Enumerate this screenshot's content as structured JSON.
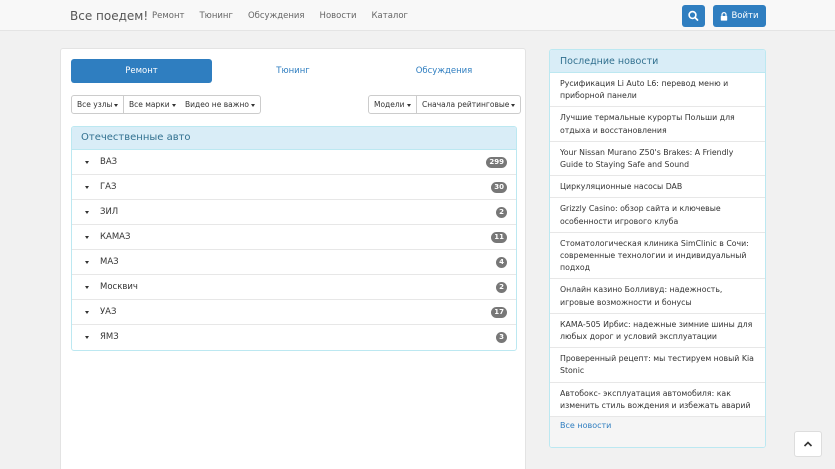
{
  "navbar": {
    "brand": "Все поедем!",
    "links": [
      "Ремонт",
      "Тюнинг",
      "Обсуждения",
      "Новости",
      "Каталог"
    ],
    "login_label": "Войти",
    "accent": "#2f7ec0"
  },
  "tabs": [
    "Ремонт",
    "Тюнинг",
    "Обсуждения"
  ],
  "filters": {
    "nodes": "Все узлы",
    "brands": "Все марки",
    "video": "Видео не важно",
    "models": "Модели",
    "sort": "Сначала рейтинговые"
  },
  "panel": {
    "title": "Отечественные авто",
    "items": [
      {
        "name": "ВАЗ",
        "count": "299"
      },
      {
        "name": "ГАЗ",
        "count": "30"
      },
      {
        "name": "ЗИЛ",
        "count": "2"
      },
      {
        "name": "КАМАЗ",
        "count": "11"
      },
      {
        "name": "МАЗ",
        "count": "4"
      },
      {
        "name": "Москвич",
        "count": "2"
      },
      {
        "name": "УАЗ",
        "count": "17"
      },
      {
        "name": "ЯМЗ",
        "count": "3"
      }
    ]
  },
  "news": {
    "title": "Последние новости",
    "items": [
      "Русификация Li Auto L6: перевод меню и приборной панели",
      "Лучшие термальные курорты Польши для отдыха и восстановления",
      "Your Nissan Murano Z50's Brakes: A Friendly Guide to Staying Safe and Sound",
      "Циркуляционные насосы DAB",
      "Grizzly Casino: обзор сайта и ключевые особенности игрового клуба",
      "Стоматологическая клиника SimClinic в Сочи: современные технологии и индивидуальный подход",
      "Онлайн казино Болливуд: надежность, игровые возможности и бонусы",
      "КАМА-505 Ирбис: надежные зимние шины для любых дорог и условий эксплуатации",
      "Проверенный рецепт: мы тестируем новый Kia Stonic",
      "Автобокс- эксплуатация автомобиля: как изменить стиль вождения и избежать аварий"
    ],
    "all_label": "Все новости"
  }
}
